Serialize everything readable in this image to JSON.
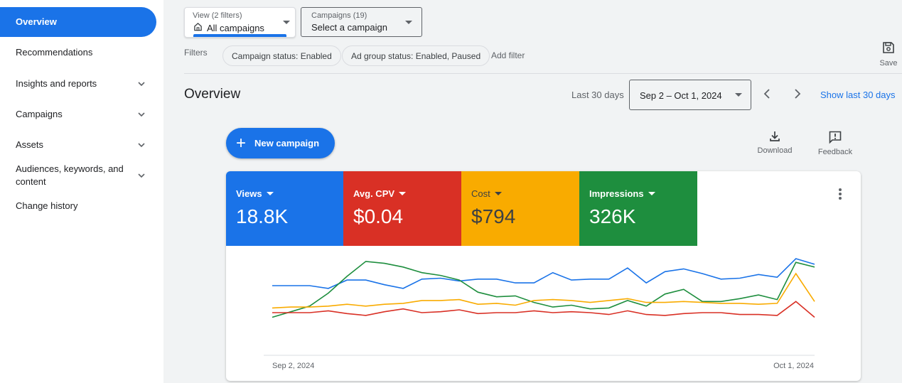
{
  "sidebar": {
    "items": [
      {
        "label": "Overview",
        "active": true,
        "expandable": false
      },
      {
        "label": "Recommendations",
        "active": false,
        "expandable": false
      },
      {
        "label": "Insights and reports",
        "active": false,
        "expandable": true
      },
      {
        "label": "Campaigns",
        "active": false,
        "expandable": true
      },
      {
        "label": "Assets",
        "active": false,
        "expandable": true
      },
      {
        "label": "Audiences, keywords, and content",
        "active": false,
        "expandable": true
      },
      {
        "label": "Change history",
        "active": false,
        "expandable": false
      }
    ]
  },
  "view_filter": {
    "label": "View (2 filters)",
    "value": "All campaigns",
    "icon": "home-icon"
  },
  "campaign_selector": {
    "label": "Campaigns (19)",
    "value": "Select a campaign"
  },
  "filters": {
    "label": "Filters",
    "chips": [
      "Campaign status: Enabled",
      "Ad group status: Enabled, Paused"
    ],
    "add_label": "Add filter"
  },
  "save": {
    "label": "Save",
    "icon": "save-icon"
  },
  "overview": {
    "title": "Overview",
    "range_label": "Last 30 days",
    "date_range": "Sep 2 – Oct 1, 2024",
    "show_last": "Show last 30 days"
  },
  "actions": {
    "new_campaign": "New campaign",
    "download": "Download",
    "feedback": "Feedback"
  },
  "metrics": [
    {
      "name": "Views",
      "value": "18.8K",
      "color": "#1a73e8"
    },
    {
      "name": "Avg. CPV",
      "value": "$0.04",
      "color": "#d93025"
    },
    {
      "name": "Cost",
      "value": "$794",
      "color": "#f9ab00"
    },
    {
      "name": "Impressions",
      "value": "326K",
      "color": "#1e8e3e"
    }
  ],
  "chart_data": {
    "type": "line",
    "x_start_label": "Sep 2, 2024",
    "x_end_label": "Oct 1, 2024",
    "grid": false,
    "ylim": [
      0,
      100
    ],
    "series": [
      {
        "color": "#1a73e8",
        "values": [
          71,
          71,
          71,
          68,
          77,
          77,
          72,
          68,
          78,
          79,
          76,
          78,
          78,
          74,
          74,
          85,
          77,
          78,
          78,
          90,
          74,
          86,
          89,
          84,
          78,
          79,
          83,
          80,
          100,
          94
        ]
      },
      {
        "color": "#1e8e3e",
        "values": [
          37,
          43,
          49,
          63,
          81,
          97,
          95,
          91,
          85,
          82,
          77,
          64,
          59,
          60,
          53,
          48,
          50,
          46,
          47,
          55,
          49,
          62,
          67,
          54,
          54,
          57,
          61,
          56,
          96,
          91
        ]
      },
      {
        "color": "#f9ab00",
        "values": [
          47,
          48,
          48,
          49,
          51,
          49,
          51,
          52,
          55,
          55,
          56,
          51,
          52,
          50,
          55,
          56,
          55,
          53,
          55,
          57,
          53,
          53,
          54,
          53,
          52,
          52,
          51,
          52,
          84,
          54
        ]
      },
      {
        "color": "#d93025",
        "values": [
          42,
          42,
          42,
          44,
          41,
          39,
          43,
          46,
          42,
          43,
          45,
          41,
          42,
          42,
          44,
          42,
          43,
          42,
          40,
          44,
          40,
          39,
          41,
          42,
          42,
          40,
          40,
          39,
          54,
          37
        ]
      }
    ]
  }
}
